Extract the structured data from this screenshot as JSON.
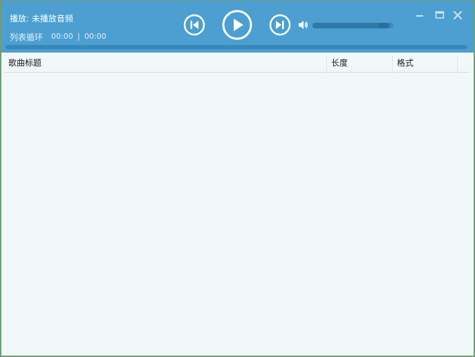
{
  "player": {
    "now_playing": "播放: 未播放音频",
    "loop_mode": "列表循环",
    "current_time": "00:00",
    "separator": "|",
    "total_time": "00:00",
    "volume_fraction": 0.95,
    "progress_fraction": 0.0
  },
  "icons": {
    "prev": "skip-previous-icon",
    "play": "play-icon",
    "next": "skip-next-icon",
    "volume": "speaker-icon",
    "minimize": "minimize-icon",
    "maximize": "maximize-icon",
    "close": "close-icon"
  },
  "playlist": {
    "columns": [
      "歌曲标题",
      "长度",
      "格式"
    ],
    "rows": []
  },
  "colors": {
    "titlebar": "#4c9fd0",
    "list_background": "#f1f8f7"
  }
}
